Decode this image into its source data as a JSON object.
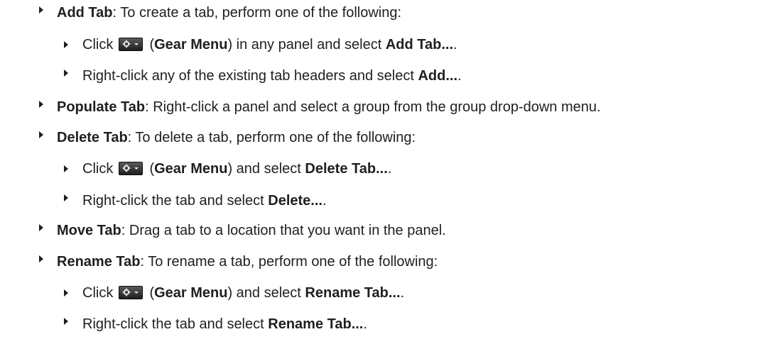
{
  "items": [
    {
      "lead": "Add Tab",
      "rest": ": To create a tab, perform one of the following:"
    },
    {
      "pre": "Click ",
      "icon": "gear-menu-icon",
      "mid": " (",
      "bold1": "Gear Menu",
      "mid2": ") in any panel and select ",
      "bold2": "Add Tab...",
      "end": "."
    },
    {
      "pre": "Right-click any of the existing tab headers and select ",
      "bold2": "Add...",
      "end": "."
    },
    {
      "lead": "Populate Tab",
      "rest": ": Right-click a panel and select a group from the group drop-down menu."
    },
    {
      "lead": "Delete Tab",
      "rest": ": To delete a tab, perform one of the following:"
    },
    {
      "pre": "Click ",
      "icon": "gear-menu-icon",
      "mid": " (",
      "bold1": "Gear Menu",
      "mid2": ") and select ",
      "bold2": "Delete Tab...",
      "end": "."
    },
    {
      "pre": "Right-click the tab and select ",
      "bold2": "Delete...",
      "end": "."
    },
    {
      "lead": "Move Tab",
      "rest": ": Drag a tab to a location that you want in the panel."
    },
    {
      "lead": "Rename Tab",
      "rest": ": To rename a tab, perform one of the following:"
    },
    {
      "pre": "Click ",
      "icon": "gear-menu-icon",
      "mid": " (",
      "bold1": "Gear Menu",
      "mid2": ") and select ",
      "bold2": "Rename Tab...",
      "end": "."
    },
    {
      "pre": "Right-click the tab and select ",
      "bold2": "Rename Tab...",
      "end": "."
    }
  ]
}
